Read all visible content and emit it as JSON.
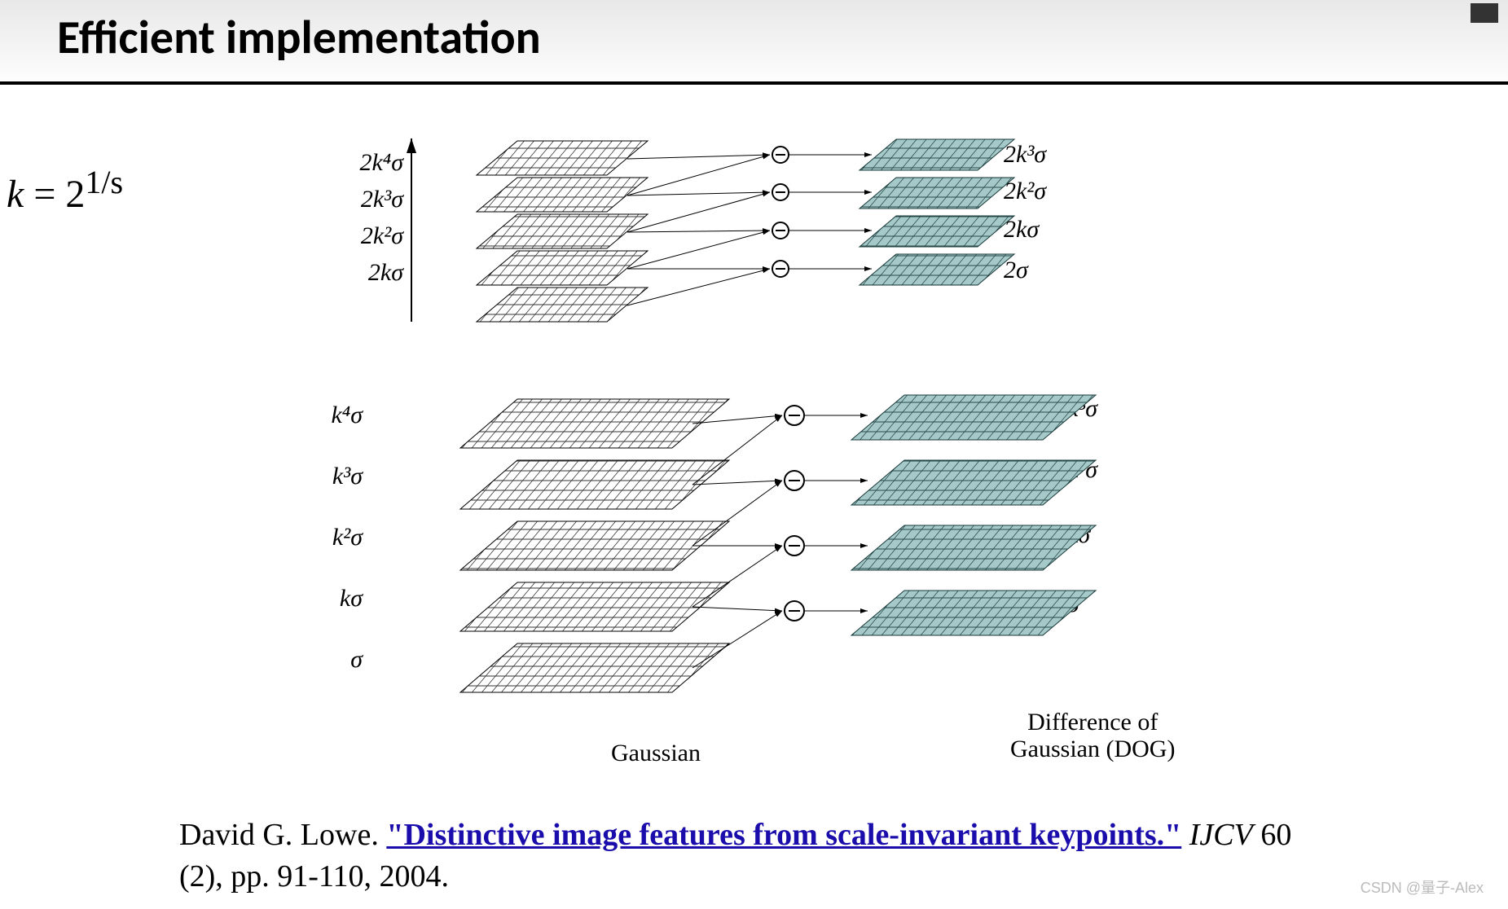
{
  "header": {
    "title": "Efficient implementation"
  },
  "equation": {
    "k": "k",
    "eq": " = 2",
    "sup": "1/s"
  },
  "diagram": {
    "dots": ". .",
    "gaussian_caption": "Gaussian",
    "dog_caption_line1": "Difference of",
    "dog_caption_line2": "Gaussian (DOG)",
    "octave2": {
      "gaussian_labels": [
        "2kσ",
        "2k²σ",
        "2k³σ",
        "2k⁴σ"
      ],
      "dog_labels": [
        "2σ",
        "2kσ",
        "2k²σ",
        "2k³σ"
      ]
    },
    "octave1": {
      "gaussian_labels": [
        "σ",
        "kσ",
        "k²σ",
        "k³σ",
        "k⁴σ"
      ],
      "dog_labels": [
        "σ",
        "kσ",
        "k²σ",
        "k³σ"
      ]
    }
  },
  "citation": {
    "author": "David G. Lowe. ",
    "link": "\"Distinctive image features from scale-invariant keypoints.\"",
    "journal": " IJCV",
    "rest": " 60 (2), pp. 91-110, 2004."
  },
  "watermark": "CSDN @量子-Alex"
}
